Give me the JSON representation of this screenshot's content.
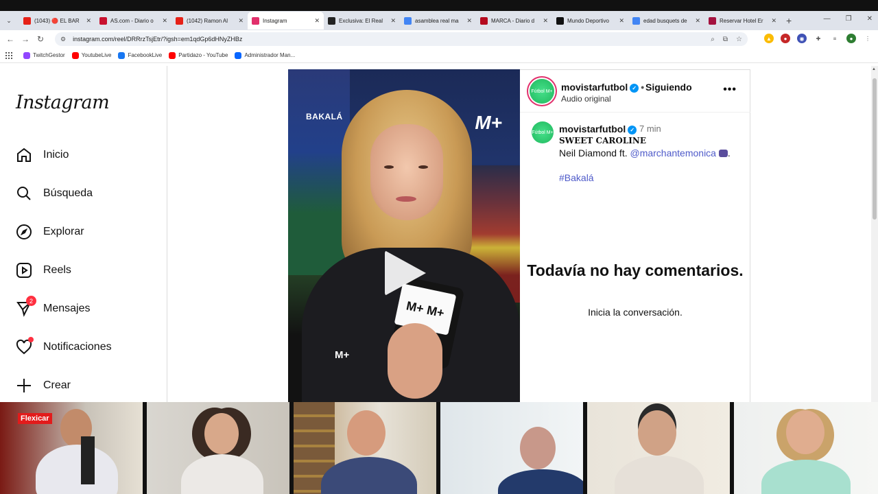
{
  "browser": {
    "tabs": [
      {
        "label": "(1043) 🔴 EL BAR",
        "color": "#e62117"
      },
      {
        "label": "AS.com - Diario o",
        "color": "#c8102e"
      },
      {
        "label": "(1042) Ramon Al",
        "color": "#e62117"
      },
      {
        "label": "Instagram",
        "color": "#e1306c",
        "active": true
      },
      {
        "label": "Exclusiva: El Real",
        "color": "#222222"
      },
      {
        "label": "asamblea real ma",
        "color": "#4285f4"
      },
      {
        "label": "MARCA - Diario d",
        "color": "#b50a1f"
      },
      {
        "label": "Mundo Deportivo",
        "color": "#111111"
      },
      {
        "label": "edad busquets de",
        "color": "#4285f4"
      },
      {
        "label": "Reservar Hotel Er",
        "color": "#a4123f"
      }
    ],
    "url": "instagram.com/reel/DRRrzTsjEtr/?igsh=em1qdGp6dHNyZHBz",
    "bookmarks": [
      {
        "label": "TwitchGestor",
        "color": "#9146ff"
      },
      {
        "label": "YoutubeLive",
        "color": "#ff0000"
      },
      {
        "label": "FacebookLive",
        "color": "#1877f2"
      },
      {
        "label": "Partidazo - YouTube",
        "color": "#ff0000"
      },
      {
        "label": "Administrador Man...",
        "color": "#0866ff"
      }
    ]
  },
  "sidebar": {
    "logo": "Instagram",
    "items": [
      {
        "label": "Inicio",
        "icon": "home-icon"
      },
      {
        "label": "Búsqueda",
        "icon": "search-icon"
      },
      {
        "label": "Explorar",
        "icon": "compass-icon"
      },
      {
        "label": "Reels",
        "icon": "reels-icon"
      },
      {
        "label": "Mensajes",
        "icon": "messenger-icon",
        "badge": "2"
      },
      {
        "label": "Notificaciones",
        "icon": "heart-icon"
      },
      {
        "label": "Crear",
        "icon": "plus-icon"
      }
    ]
  },
  "reel": {
    "overlay_left": "BAKALÁ",
    "overlay_right": "M+",
    "mic_text": "M+ M+",
    "lower_text": "M+"
  },
  "post": {
    "username": "movistarfutbol",
    "follow_status": "Siguiendo",
    "audio": "Audio original",
    "avatar_text": "Fútbol M+",
    "caption": {
      "username": "movistarfutbol",
      "time": "7 min",
      "title": "SWEET CAROLINE",
      "line_prefix": "Neil Diamond ft. ",
      "mention": "@marchantemonica",
      "hashtag": "#Bakalá"
    },
    "empty_title": "Todavía no hay comentarios.",
    "empty_subtitle": "Inicia la conversación."
  },
  "call": {
    "sign_text": "Flexicar"
  }
}
